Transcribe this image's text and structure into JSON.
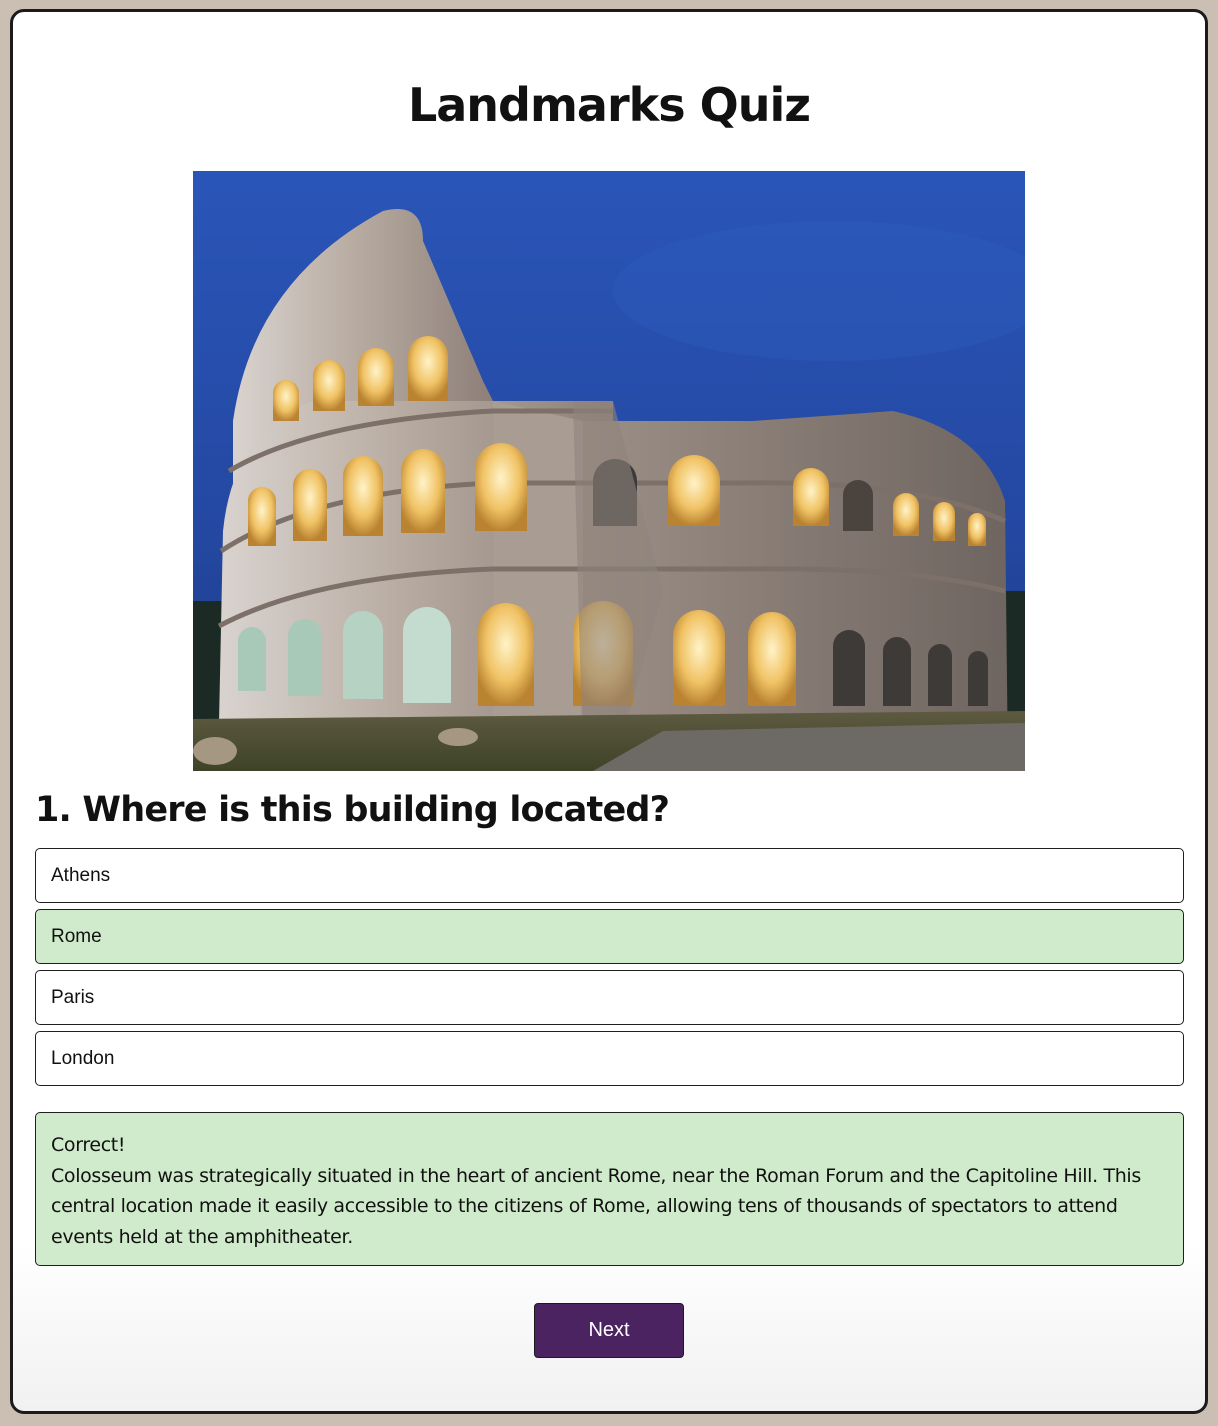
{
  "quiz": {
    "title": "Landmarks Quiz",
    "question": "1. Where is this building located?",
    "options": [
      {
        "label": "Athens",
        "state": "default"
      },
      {
        "label": "Rome",
        "state": "correct"
      },
      {
        "label": "Paris",
        "state": "default"
      },
      {
        "label": "London",
        "state": "default"
      }
    ],
    "feedback": {
      "status": "Correct!",
      "explanation": "Colosseum was strategically situated in the heart of ancient Rome, near the Roman Forum and the Capitoline Hill. This central location made it easily accessible to the citizens of Rome, allowing tens of thousands of spectators to attend events held at the amphitheater."
    },
    "next_label": "Next"
  },
  "colors": {
    "correct_bg": "#d0ebcb",
    "button_bg": "#4c2361",
    "page_bg": "#cbbfb4"
  }
}
